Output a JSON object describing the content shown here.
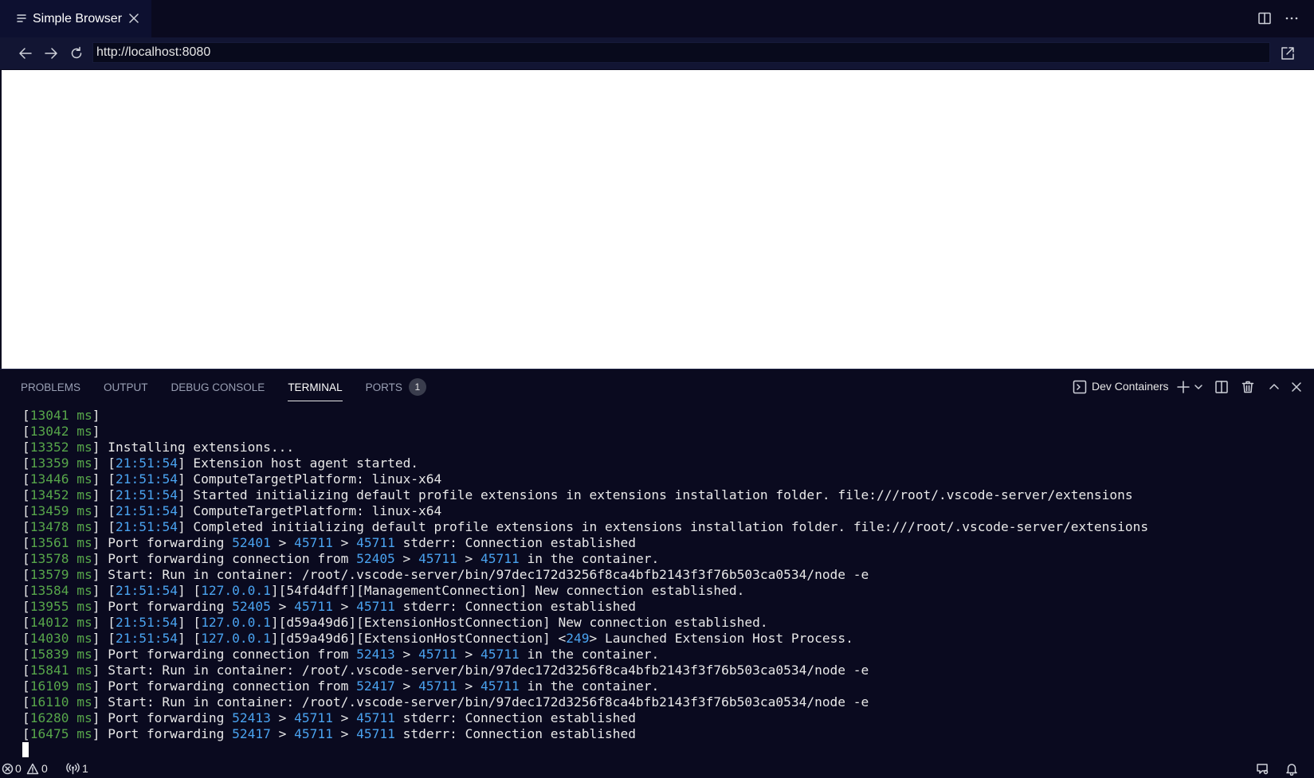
{
  "tab": {
    "title": "Simple Browser"
  },
  "nav": {
    "url": "http://localhost:8080"
  },
  "panel": {
    "tabs": [
      "PROBLEMS",
      "OUTPUT",
      "DEBUG CONSOLE",
      "TERMINAL",
      "PORTS"
    ],
    "active_tab": "TERMINAL",
    "ports_badge": "1",
    "terminal_name": "Dev Containers"
  },
  "terminal": {
    "lines": [
      [
        [
          "[",
          ""
        ],
        [
          "13041 ms",
          "ms"
        ],
        [
          "]",
          ""
        ]
      ],
      [
        [
          "[",
          ""
        ],
        [
          "13042 ms",
          "ms"
        ],
        [
          "]",
          ""
        ]
      ],
      [
        [
          "[",
          ""
        ],
        [
          "13352 ms",
          "ms"
        ],
        [
          "] Installing extensions...",
          ""
        ]
      ],
      [
        [
          "[",
          ""
        ],
        [
          "13359 ms",
          "ms"
        ],
        [
          "] [",
          ""
        ],
        [
          "21:51:54",
          "num"
        ],
        [
          "] Extension host agent started.",
          ""
        ]
      ],
      [
        [
          "[",
          ""
        ],
        [
          "13446 ms",
          "ms"
        ],
        [
          "] [",
          ""
        ],
        [
          "21:51:54",
          "num"
        ],
        [
          "] ComputeTargetPlatform: linux-x64",
          ""
        ]
      ],
      [
        [
          "[",
          ""
        ],
        [
          "13452 ms",
          "ms"
        ],
        [
          "] [",
          ""
        ],
        [
          "21:51:54",
          "num"
        ],
        [
          "] Started initializing default profile extensions in extensions installation folder. file:///root/.vscode-server/extensions",
          ""
        ]
      ],
      [
        [
          "[",
          ""
        ],
        [
          "13459 ms",
          "ms"
        ],
        [
          "] [",
          ""
        ],
        [
          "21:51:54",
          "num"
        ],
        [
          "] ComputeTargetPlatform: linux-x64",
          ""
        ]
      ],
      [
        [
          "[",
          ""
        ],
        [
          "13478 ms",
          "ms"
        ],
        [
          "] [",
          ""
        ],
        [
          "21:51:54",
          "num"
        ],
        [
          "] Completed initializing default profile extensions in extensions installation folder. file:///root/.vscode-server/extensions",
          ""
        ]
      ],
      [
        [
          "[",
          ""
        ],
        [
          "13561 ms",
          "ms"
        ],
        [
          "] Port forwarding ",
          ""
        ],
        [
          "52401",
          "num"
        ],
        [
          " > ",
          ""
        ],
        [
          "45711",
          "num"
        ],
        [
          " > ",
          ""
        ],
        [
          "45711",
          "num"
        ],
        [
          " stderr: Connection established",
          ""
        ]
      ],
      [
        [
          "[",
          ""
        ],
        [
          "13578 ms",
          "ms"
        ],
        [
          "] Port forwarding connection from ",
          ""
        ],
        [
          "52405",
          "num"
        ],
        [
          " > ",
          ""
        ],
        [
          "45711",
          "num"
        ],
        [
          " > ",
          ""
        ],
        [
          "45711",
          "num"
        ],
        [
          " in the container.",
          ""
        ]
      ],
      [
        [
          "[",
          ""
        ],
        [
          "13579 ms",
          "ms"
        ],
        [
          "] Start: Run in container: /root/.vscode-server/bin/97dec172d3256f8ca4bfb2143f3f76b503ca0534/node -e",
          ""
        ]
      ],
      [
        [
          "[",
          ""
        ],
        [
          "13584 ms",
          "ms"
        ],
        [
          "] [",
          ""
        ],
        [
          "21:51:54",
          "num"
        ],
        [
          "] [",
          ""
        ],
        [
          "127.0.0.1",
          "num"
        ],
        [
          "][54fd4dff][ManagementConnection] New connection established.",
          ""
        ]
      ],
      [
        [
          "[",
          ""
        ],
        [
          "13955 ms",
          "ms"
        ],
        [
          "] Port forwarding ",
          ""
        ],
        [
          "52405",
          "num"
        ],
        [
          " > ",
          ""
        ],
        [
          "45711",
          "num"
        ],
        [
          " > ",
          ""
        ],
        [
          "45711",
          "num"
        ],
        [
          " stderr: Connection established",
          ""
        ]
      ],
      [
        [
          "[",
          ""
        ],
        [
          "14012 ms",
          "ms"
        ],
        [
          "] [",
          ""
        ],
        [
          "21:51:54",
          "num"
        ],
        [
          "] [",
          ""
        ],
        [
          "127.0.0.1",
          "num"
        ],
        [
          "][d59a49d6][ExtensionHostConnection] New connection established.",
          ""
        ]
      ],
      [
        [
          "[",
          ""
        ],
        [
          "14030 ms",
          "ms"
        ],
        [
          "] [",
          ""
        ],
        [
          "21:51:54",
          "num"
        ],
        [
          "] [",
          ""
        ],
        [
          "127.0.0.1",
          "num"
        ],
        [
          "][d59a49d6][ExtensionHostConnection] <",
          ""
        ],
        [
          "249",
          "num"
        ],
        [
          "> Launched Extension Host Process.",
          ""
        ]
      ],
      [
        [
          "[",
          ""
        ],
        [
          "15839 ms",
          "ms"
        ],
        [
          "] Port forwarding connection from ",
          ""
        ],
        [
          "52413",
          "num"
        ],
        [
          " > ",
          ""
        ],
        [
          "45711",
          "num"
        ],
        [
          " > ",
          ""
        ],
        [
          "45711",
          "num"
        ],
        [
          " in the container.",
          ""
        ]
      ],
      [
        [
          "[",
          ""
        ],
        [
          "15841 ms",
          "ms"
        ],
        [
          "] Start: Run in container: /root/.vscode-server/bin/97dec172d3256f8ca4bfb2143f3f76b503ca0534/node -e",
          ""
        ]
      ],
      [
        [
          "[",
          ""
        ],
        [
          "16109 ms",
          "ms"
        ],
        [
          "] Port forwarding connection from ",
          ""
        ],
        [
          "52417",
          "num"
        ],
        [
          " > ",
          ""
        ],
        [
          "45711",
          "num"
        ],
        [
          " > ",
          ""
        ],
        [
          "45711",
          "num"
        ],
        [
          " in the container.",
          ""
        ]
      ],
      [
        [
          "[",
          ""
        ],
        [
          "16110 ms",
          "ms"
        ],
        [
          "] Start: Run in container: /root/.vscode-server/bin/97dec172d3256f8ca4bfb2143f3f76b503ca0534/node -e",
          ""
        ]
      ],
      [
        [
          "[",
          ""
        ],
        [
          "16280 ms",
          "ms"
        ],
        [
          "] Port forwarding ",
          ""
        ],
        [
          "52413",
          "num"
        ],
        [
          " > ",
          ""
        ],
        [
          "45711",
          "num"
        ],
        [
          " > ",
          ""
        ],
        [
          "45711",
          "num"
        ],
        [
          " stderr: Connection established",
          ""
        ]
      ],
      [
        [
          "[",
          ""
        ],
        [
          "16475 ms",
          "ms"
        ],
        [
          "] Port forwarding ",
          ""
        ],
        [
          "52417",
          "num"
        ],
        [
          " > ",
          ""
        ],
        [
          "45711",
          "num"
        ],
        [
          " > ",
          ""
        ],
        [
          "45711",
          "num"
        ],
        [
          " stderr: Connection established",
          ""
        ]
      ]
    ]
  },
  "status": {
    "errors": "0",
    "warnings": "0",
    "ports": "1"
  },
  "colors": {
    "background": "#0a0a1f",
    "ms": "#57a64a",
    "number": "#4aa3f0"
  },
  "icons": [
    "menu-icon",
    "close-icon",
    "split-editor-icon",
    "more-icon",
    "arrow-left-icon",
    "arrow-right-icon",
    "refresh-icon",
    "external-link-icon",
    "terminal-icon",
    "plus-icon",
    "chevron-down-icon",
    "split-icon",
    "trash-icon",
    "chevron-up-icon",
    "error-icon",
    "warning-icon",
    "broadcast-icon",
    "feedback-icon",
    "bell-icon"
  ]
}
